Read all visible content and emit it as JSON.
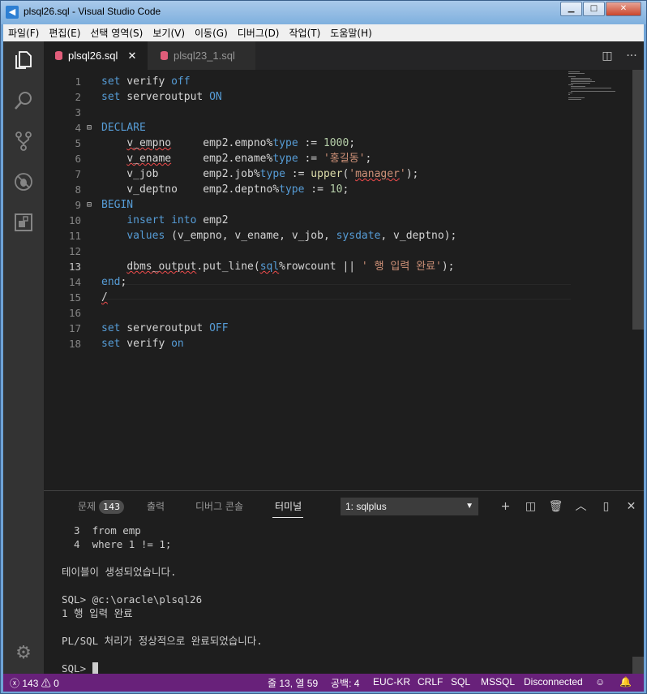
{
  "window": {
    "title": "plsql26.sql - Visual Studio Code",
    "app_icon": "vscode-icon",
    "buttons": [
      "minimize",
      "maximize",
      "close"
    ]
  },
  "menu": [
    "파일(F)",
    "편집(E)",
    "선택 영역(S)",
    "보기(V)",
    "이동(G)",
    "디버그(D)",
    "작업(T)",
    "도움말(H)"
  ],
  "activity_bar": [
    "explorer-icon",
    "search-icon",
    "source-control-icon",
    "debug-icon",
    "extensions-icon",
    "gear-icon"
  ],
  "tabs": [
    {
      "label": "plsql26.sql",
      "active": true
    },
    {
      "label": "plsql23_1.sql",
      "active": false
    }
  ],
  "editor": {
    "line_numbers": [
      "1",
      "2",
      "3",
      "4",
      "5",
      "6",
      "7",
      "8",
      "9",
      "10",
      "11",
      "12",
      "13",
      "14",
      "15",
      "16",
      "17",
      "18"
    ],
    "current_line": 13
  },
  "panel": {
    "tabs": {
      "problems": "문제",
      "problems_count": "143",
      "output": "출력",
      "debug_console": "디버그 콘솔",
      "terminal": "터미널"
    },
    "terminal_select": "1: sqlplus",
    "terminal_lines": [
      "  3  from emp",
      "  4  where 1 != 1;",
      "",
      "테이블이 생성되었습니다.",
      "",
      "SQL> @c:\\oracle\\plsql26",
      "1 행 입력 완료",
      "",
      "PL/SQL 처리가 정상적으로 완료되었습니다.",
      ""
    ],
    "prompt": "SQL> "
  },
  "status": {
    "errors": "143",
    "warnings": "0",
    "position": "줄 13, 열 59",
    "spaces": "공백: 4",
    "encoding": "EUC-KR",
    "eol": "CRLF",
    "language": "SQL",
    "dialect": "MSSQL",
    "connection": "Disconnected"
  },
  "colors": {
    "statusbar": "#68217a",
    "keyword": "#569cd6",
    "string": "#ce9178",
    "number": "#b5cea8",
    "function": "#dcdcaa"
  }
}
